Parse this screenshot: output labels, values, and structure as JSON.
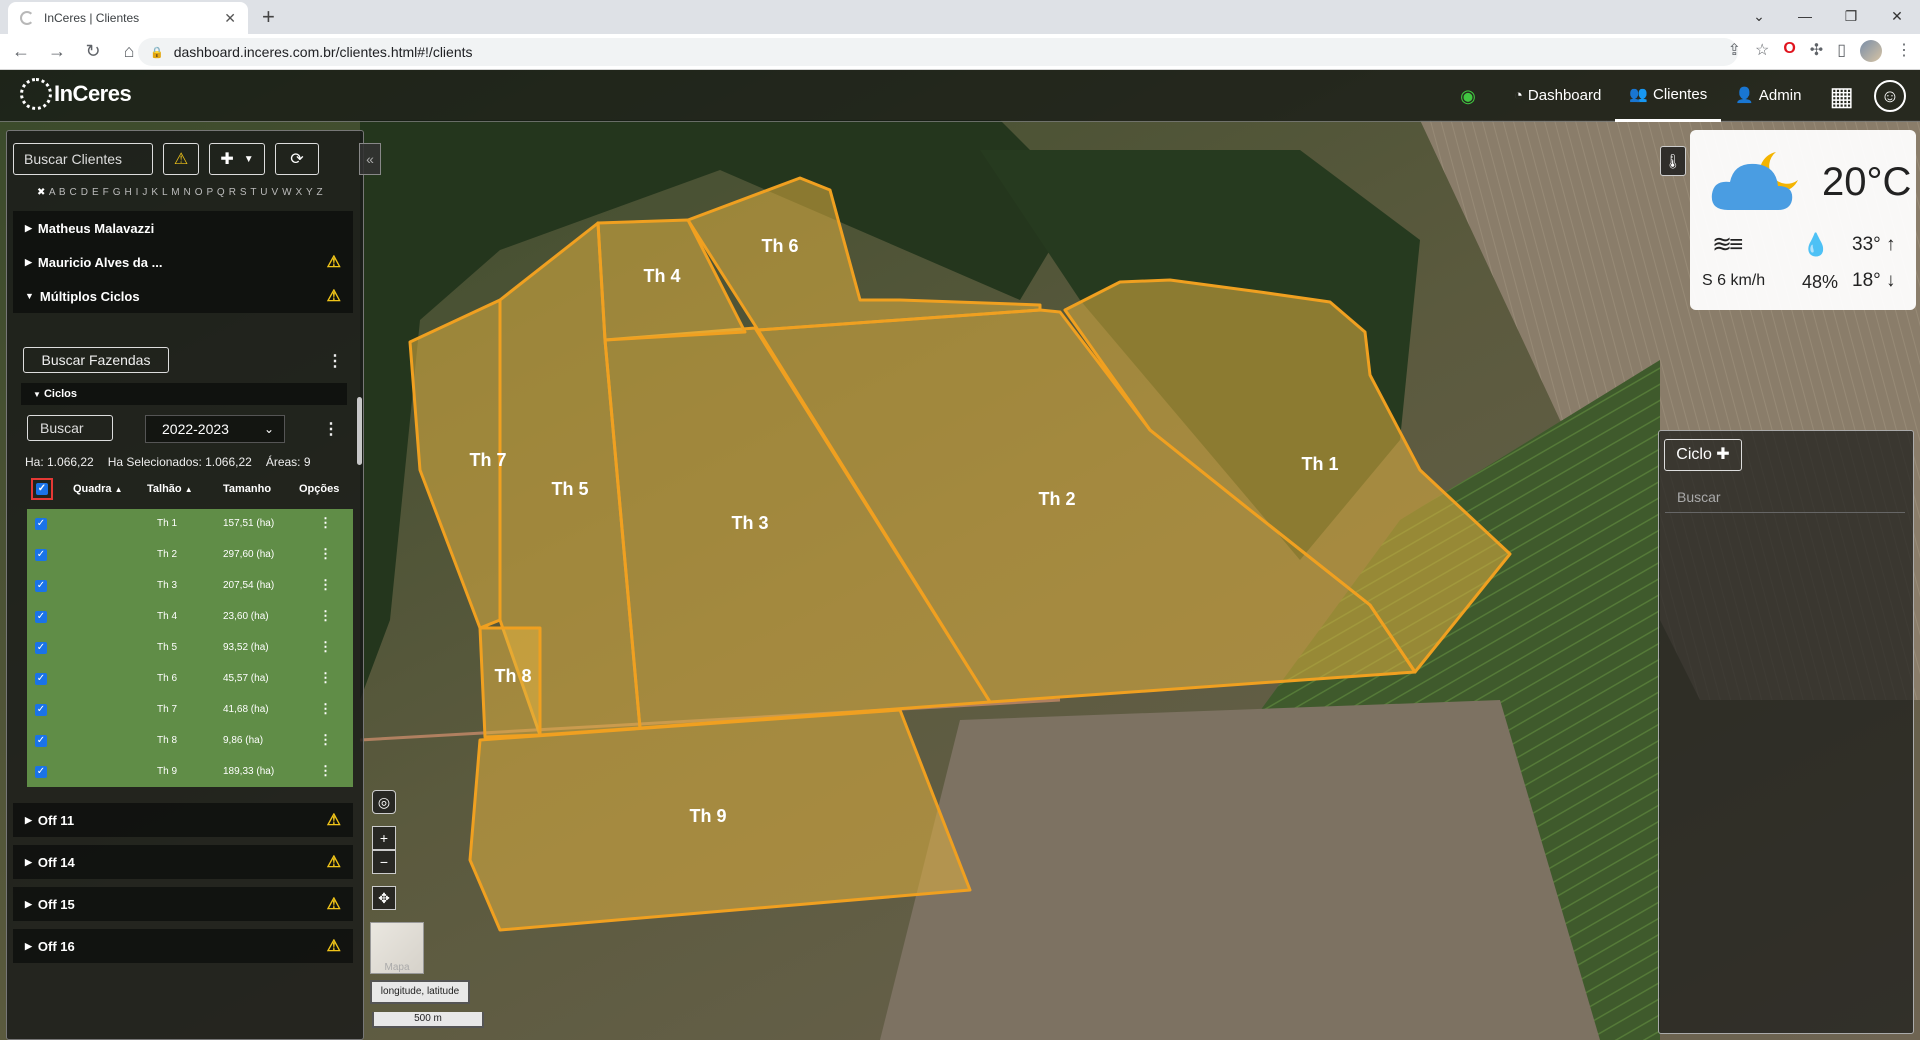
{
  "browser": {
    "tab_title": "InCeres | Clientes",
    "url": "dashboard.inceres.com.br/clientes.html#!/clients"
  },
  "app": {
    "logo_text": "InCeres",
    "nav": {
      "dashboard": "Dashboard",
      "clientes": "Clientes",
      "admin": "Admin"
    }
  },
  "sidebar": {
    "search_placeholder": "Buscar Clientes",
    "alphabet": "A B C D E F G H I J K L M N O P Q R S T U V W X Y Z",
    "clients": [
      {
        "name": "Matheus Malavazzi",
        "warning": false
      },
      {
        "name": "Mauricio Alves da ...",
        "warning": true
      },
      {
        "name": "Múltiplos Ciclos",
        "warning": true,
        "expanded": true
      },
      {
        "name": "Off 11",
        "warning": true
      },
      {
        "name": "Off 14",
        "warning": true
      },
      {
        "name": "Off 15",
        "warning": true
      },
      {
        "name": "Off 16",
        "warning": true
      }
    ],
    "fazendas_search": "Buscar Fazendas",
    "ciclos_title": "Ciclos",
    "ciclos_search": "Buscar",
    "year": "2022-2023",
    "stats": {
      "ha": "Ha: 1.066,22",
      "selected": "Ha Selecionados: 1.066,22",
      "areas": "Áreas: 9"
    },
    "table": {
      "columns": [
        "Quadra",
        "Talhão",
        "Tamanho",
        "Opções"
      ],
      "rows": [
        {
          "talhao": "Th 1",
          "tamanho": "157,51 (ha)"
        },
        {
          "talhao": "Th 2",
          "tamanho": "297,60 (ha)"
        },
        {
          "talhao": "Th 3",
          "tamanho": "207,54 (ha)"
        },
        {
          "talhao": "Th 4",
          "tamanho": "23,60 (ha)"
        },
        {
          "talhao": "Th 5",
          "tamanho": "93,52 (ha)"
        },
        {
          "talhao": "Th 6",
          "tamanho": "45,57 (ha)"
        },
        {
          "talhao": "Th 7",
          "tamanho": "41,68 (ha)"
        },
        {
          "talhao": "Th 8",
          "tamanho": "9,86 (ha)"
        },
        {
          "talhao": "Th 9",
          "tamanho": "189,33 (ha)"
        }
      ]
    }
  },
  "map": {
    "field_labels": [
      "Th 1",
      "Th 2",
      "Th 3",
      "Th 4",
      "Th 5",
      "Th 6",
      "Th 7",
      "Th 8",
      "Th 9"
    ],
    "minimap_label": "Mapa",
    "coord_label": "longitude, latitude",
    "scale_label": "500 m",
    "field_color": "#e0b040",
    "field_border": "#f0a020"
  },
  "weather": {
    "temperature": "20°C",
    "wind": "S 6 km/h",
    "humidity": "48%",
    "max": "33°",
    "min": "18°"
  },
  "right_panel": {
    "ciclo_label": "Ciclo",
    "search_placeholder": "Buscar"
  }
}
